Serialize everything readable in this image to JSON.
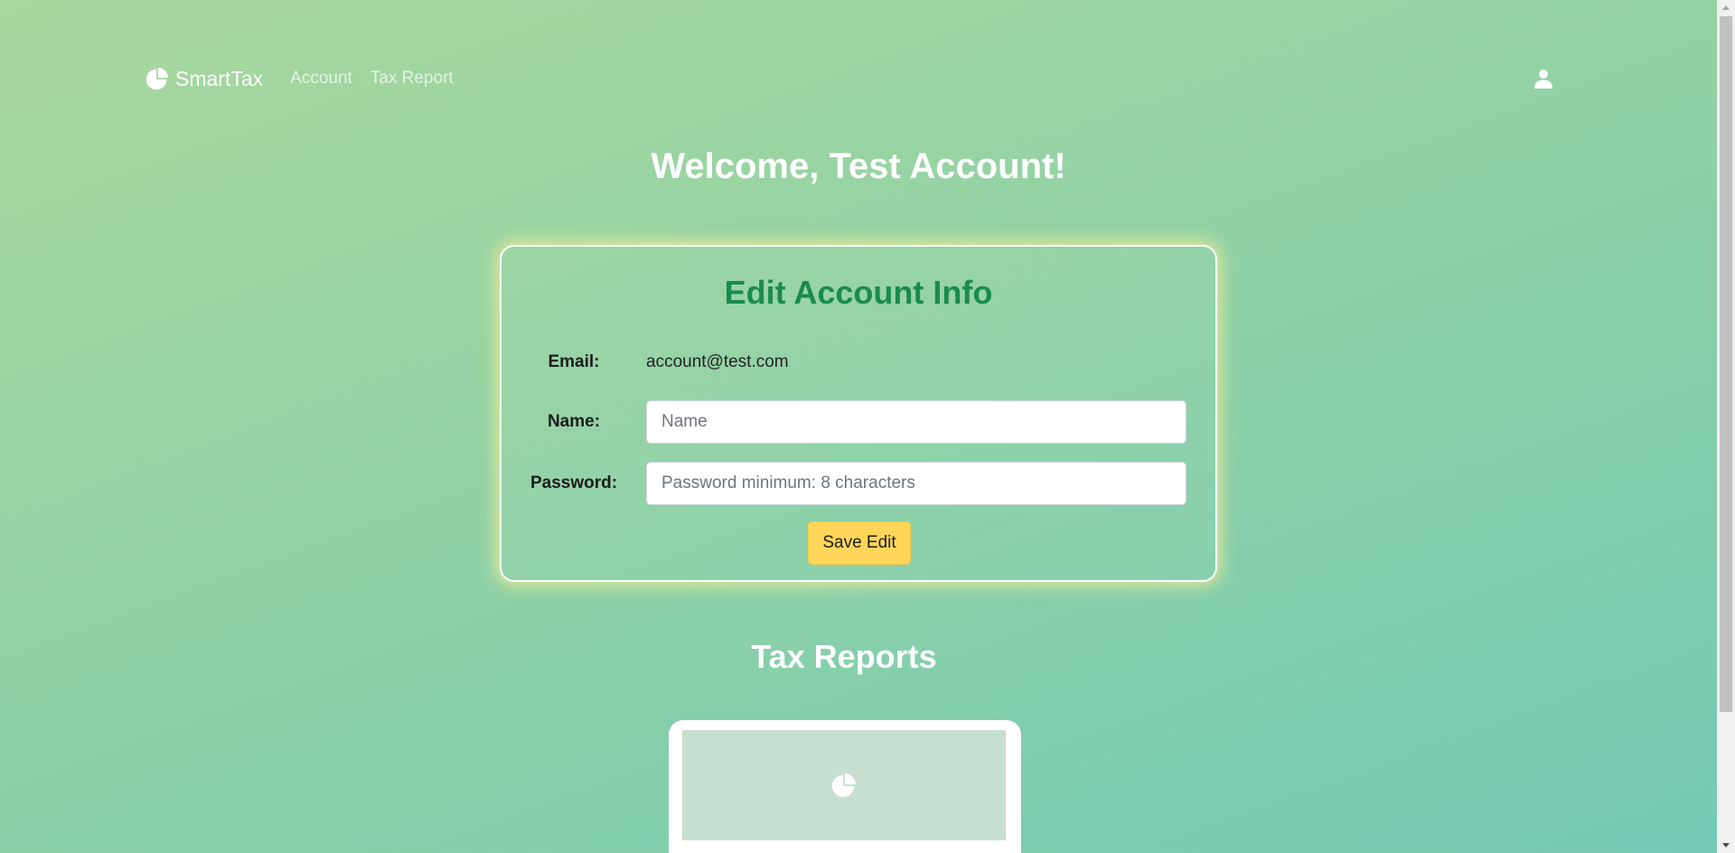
{
  "nav": {
    "brand": "SmartTax",
    "links": [
      "Account",
      "Tax Report"
    ],
    "user_icon": "user-icon",
    "brand_icon": "pie-chart-icon"
  },
  "welcome": "Welcome, Test Account!",
  "edit_card": {
    "title": "Edit Account Info",
    "email_label": "Email:",
    "email_value": "account@test.com",
    "name_label": "Name:",
    "name_placeholder": "Name",
    "password_label": "Password:",
    "password_placeholder": "Password minimum: 8 characters",
    "save_label": "Save Edit"
  },
  "reports": {
    "title": "Tax Reports",
    "thumb_icon": "pie-chart-icon"
  },
  "colors": {
    "accent_green": "#1a8a4f",
    "button_yellow": "#ffd659"
  }
}
